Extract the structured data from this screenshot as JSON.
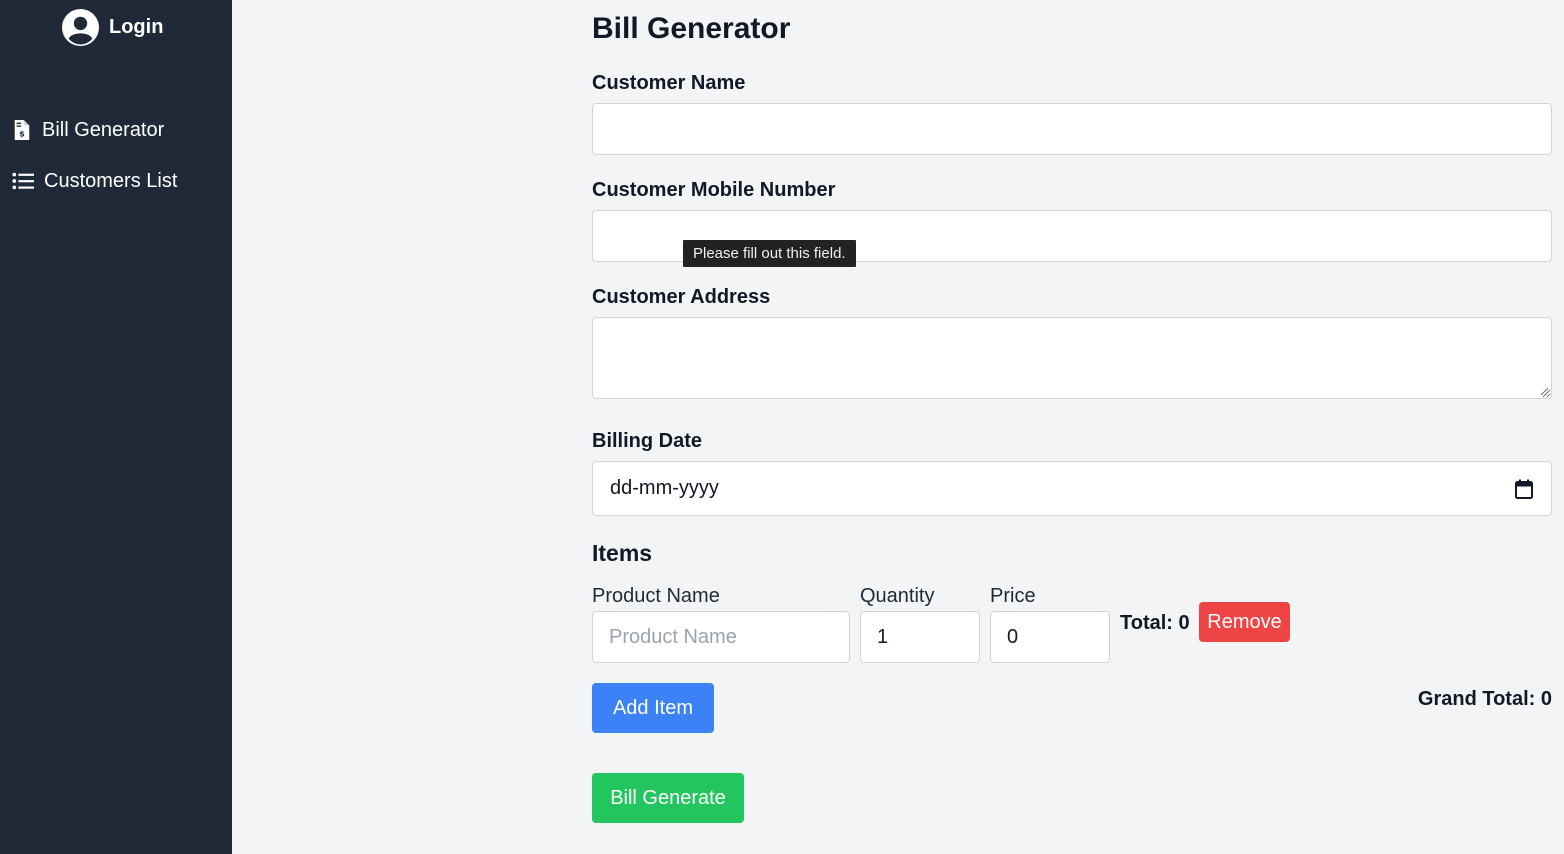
{
  "sidebar": {
    "login_label": "Login",
    "items": [
      {
        "label": "Bill Generator",
        "icon": "file-invoice-dollar-icon"
      },
      {
        "label": "Customers List",
        "icon": "list-icon"
      }
    ]
  },
  "form": {
    "title": "Bill Generator",
    "customer_name": {
      "label": "Customer Name",
      "value": ""
    },
    "customer_mobile": {
      "label": "Customer Mobile Number",
      "value": ""
    },
    "customer_address": {
      "label": "Customer Address",
      "value": ""
    },
    "billing_date": {
      "label": "Billing Date",
      "value": "dd-mm-yyyy"
    },
    "validation_tooltip": "Please fill out this field."
  },
  "items": {
    "heading": "Items",
    "columns": [
      "Product Name",
      "Quantity",
      "Price"
    ],
    "rows": [
      {
        "product_placeholder": "Product Name",
        "product_value": "",
        "quantity": "1",
        "price": "0",
        "total_label": "Total: 0",
        "remove_label": "Remove"
      }
    ],
    "add_label": "Add Item",
    "grand_total_label": "Grand Total: 0",
    "generate_label": "Bill Generate"
  },
  "colors": {
    "sidebar_bg": "#1f2937",
    "page_bg": "#f3f4f6",
    "add_button": "#3b82f6",
    "remove_button": "#ef4444",
    "generate_button": "#22c55e"
  }
}
